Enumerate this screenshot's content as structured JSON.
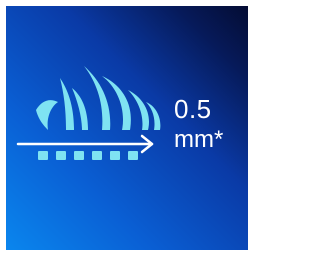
{
  "badge": {
    "value": "0.5",
    "unit": "mm*"
  },
  "colors": {
    "background_light": "#0a86ee",
    "background_dark": "#040c33",
    "hair": "#7fe3f2",
    "arrow": "#ffffff",
    "text": "#ffffff"
  },
  "icons": {
    "illustration": "hair-cut-length-icon",
    "arrow": "arrow-right-icon"
  }
}
